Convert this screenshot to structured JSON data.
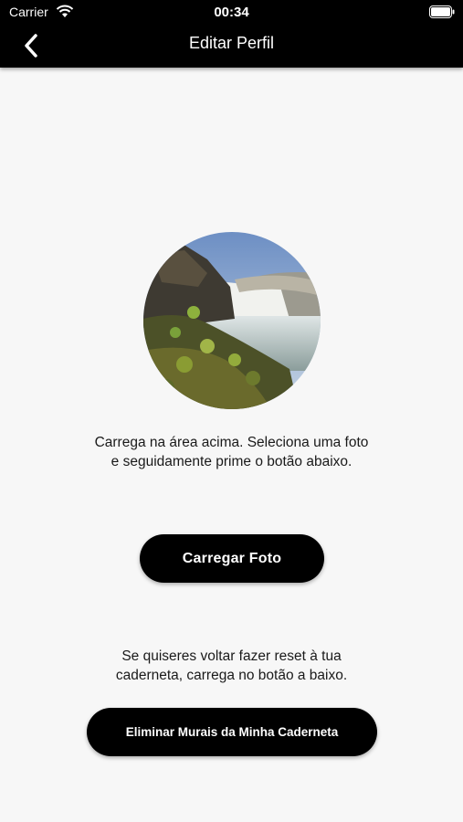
{
  "status_bar": {
    "carrier": "Carrier",
    "time": "00:34"
  },
  "header": {
    "title": "Editar Perfil",
    "back_icon": "chevron-left-icon"
  },
  "profile": {
    "photo_description": "circular-profile-photo-waterfall",
    "upload_instructions_line1": "Carrega na área acima. Seleciona uma foto",
    "upload_instructions_line2": "e seguidamente prime o botão abaixo.",
    "upload_button_label": "Carregar Foto"
  },
  "reset": {
    "instructions_line1": "Se quiseres voltar fazer reset à tua",
    "instructions_line2": "caderneta, carrega no botão a baixo.",
    "delete_button_label": "Eliminar Murais da Minha Caderneta"
  },
  "colors": {
    "bar": "#000000",
    "background": "#f7f7f7",
    "button": "#000000"
  }
}
